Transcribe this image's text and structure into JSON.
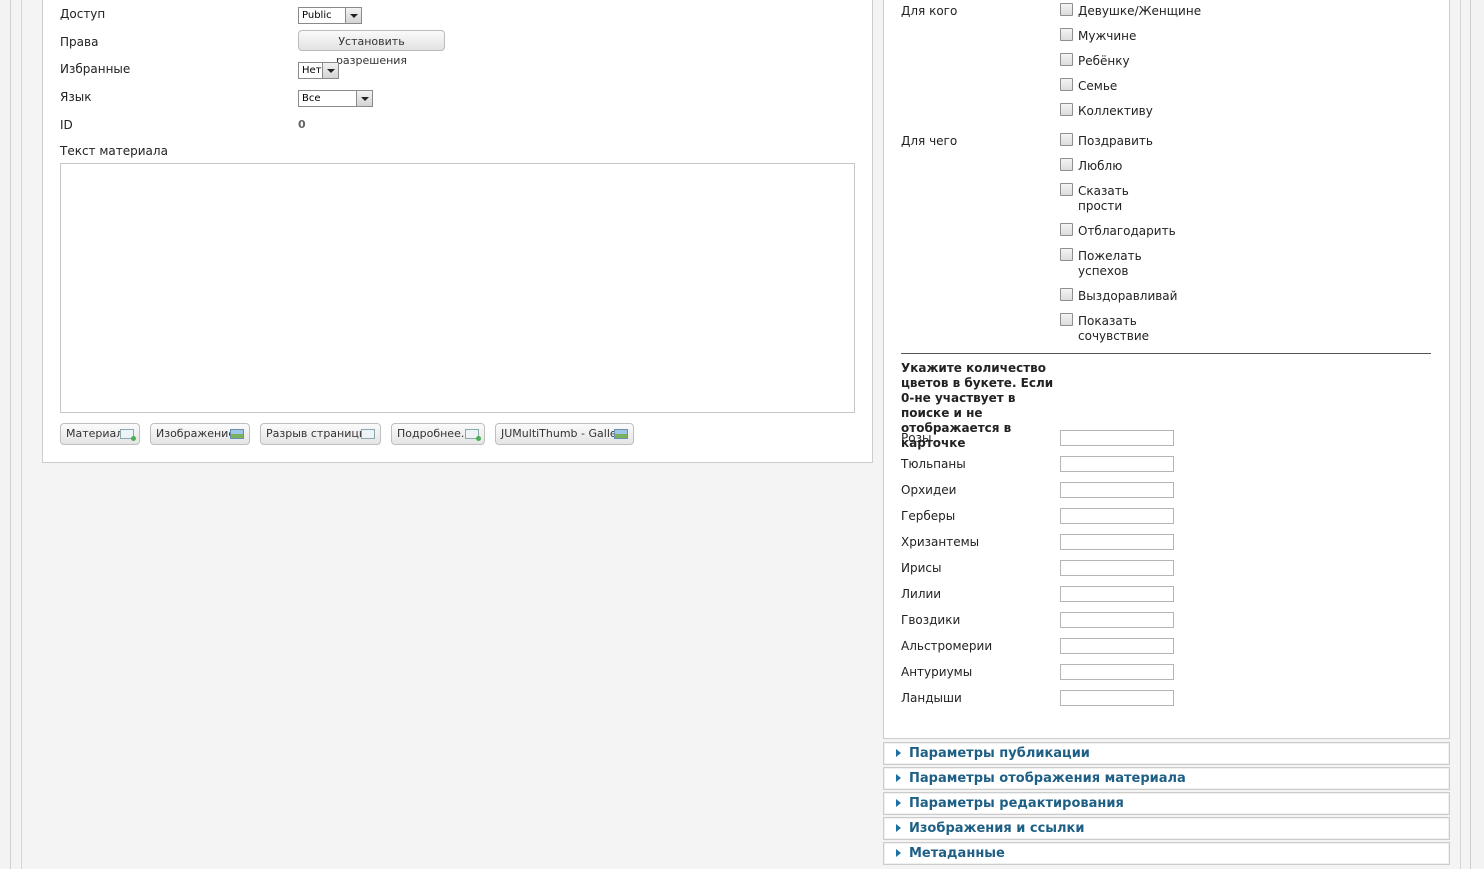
{
  "form": {
    "access": {
      "label": "Доступ",
      "value": "Public"
    },
    "rights": {
      "label": "Права",
      "button": "Установить разрешения"
    },
    "featured": {
      "label": "Избранные",
      "value": "Нет"
    },
    "language": {
      "label": "Язык",
      "value": "Все"
    },
    "id": {
      "label": "ID",
      "value": "0"
    },
    "text_label": "Текст материала"
  },
  "editor_buttons": [
    {
      "label": "Материал",
      "icon": "article-icon"
    },
    {
      "label": "Изображение",
      "icon": "image-icon"
    },
    {
      "label": "Разрыв страницы",
      "icon": "pagebreak-icon"
    },
    {
      "label": "Подробнее...",
      "icon": "readmore-icon"
    },
    {
      "label": "JUMultiThumb - Gallery",
      "icon": "gallery-icon"
    }
  ],
  "for_whom": {
    "label": "Для кого",
    "options": [
      "Девушке/Женщине",
      "Мужчине",
      "Ребёнку",
      "Семье",
      "Коллективу"
    ]
  },
  "for_what": {
    "label": "Для чего",
    "options": [
      "Поздравить",
      "Люблю",
      "Сказать прости",
      "Отблагодарить",
      "Пожелать успехов",
      "Выздоравливай",
      "Показать сочувствие"
    ]
  },
  "quantity_note": "Укажите количество цветов в букете. Если 0-не участвует в поиске и не отображается в карточке",
  "flowers": [
    "Розы",
    "Тюльпаны",
    "Орхидеи",
    "Герберы",
    "Хризантемы",
    "Ирисы",
    "Лилии",
    "Гвоздики",
    "Альстромерии",
    "Антуриумы",
    "Ландыши"
  ],
  "accordions": [
    "Параметры публикации",
    "Параметры отображения материала",
    "Параметры редактирования",
    "Изображения и ссылки",
    "Метаданные"
  ]
}
